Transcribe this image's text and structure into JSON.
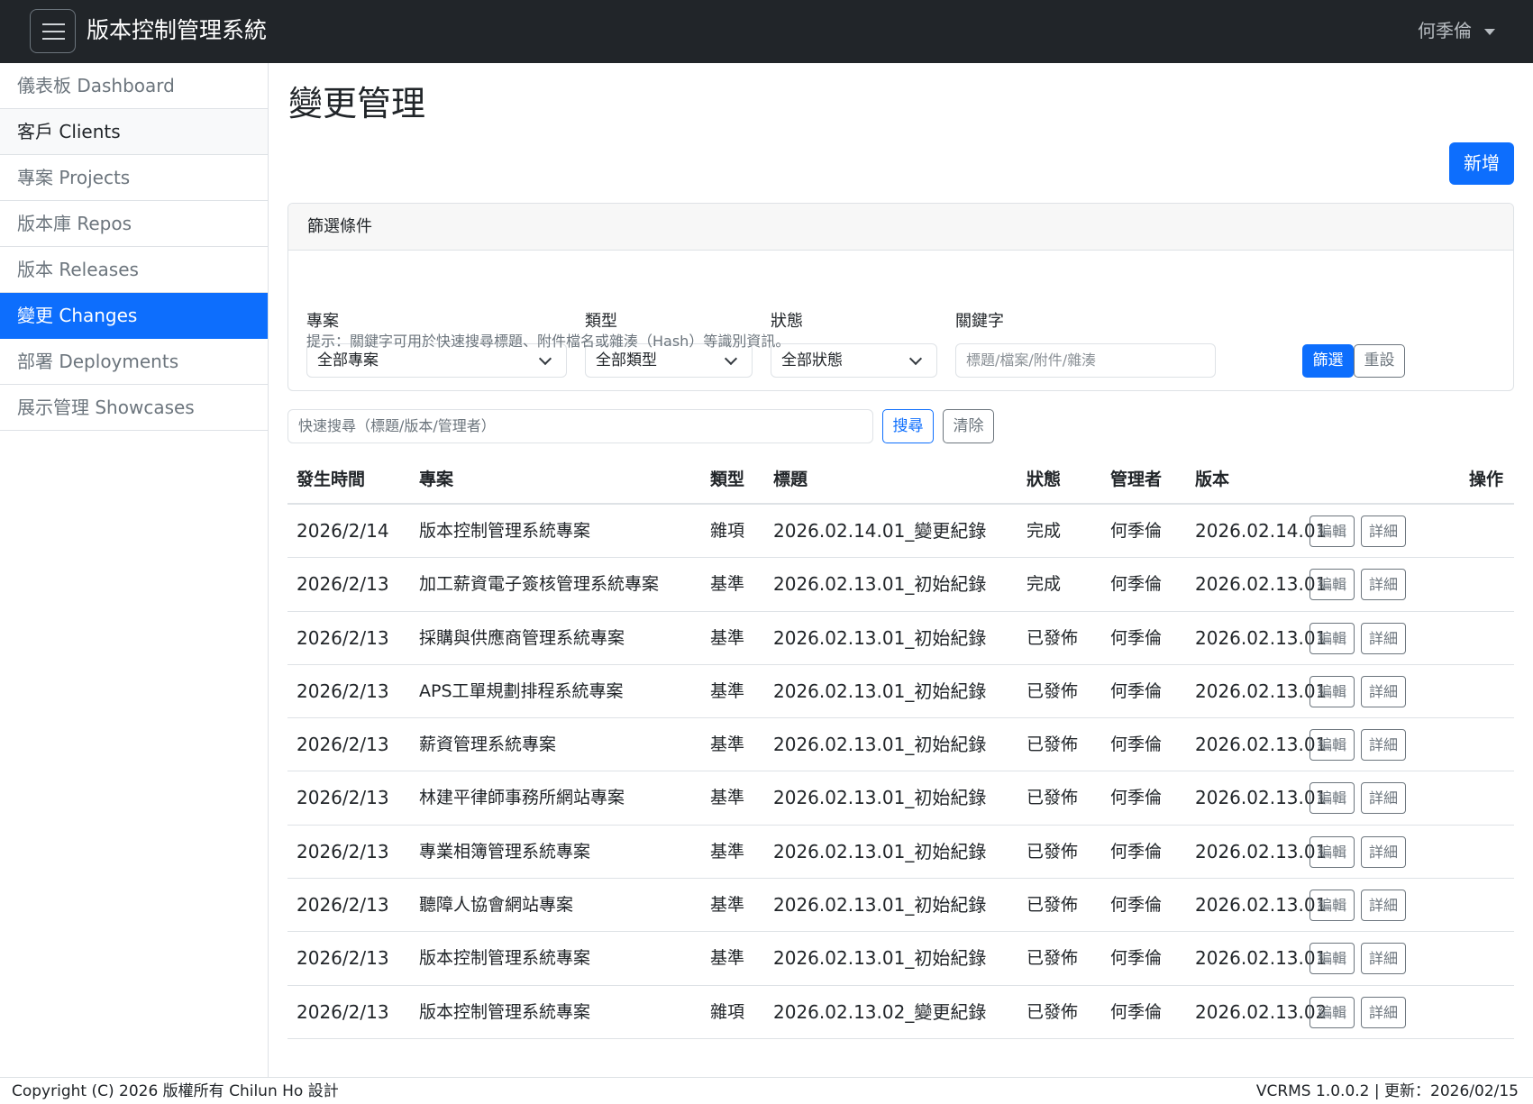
{
  "app": {
    "title": "版本控制管理系統",
    "user": "何季倫"
  },
  "sidebar": {
    "items": [
      {
        "label": "儀表板 Dashboard"
      },
      {
        "label": "客戶 Clients"
      },
      {
        "label": "專案 Projects"
      },
      {
        "label": "版本庫 Repos"
      },
      {
        "label": "版本 Releases"
      },
      {
        "label": "變更 Changes"
      },
      {
        "label": "部署 Deployments"
      },
      {
        "label": "展示管理 Showcases"
      }
    ]
  },
  "page": {
    "title": "變更管理",
    "add_label": "新增"
  },
  "filter": {
    "title": "篩選條件",
    "project_label": "專案",
    "project_value": "全部專案",
    "type_label": "類型",
    "type_value": "全部類型",
    "status_label": "狀態",
    "status_value": "全部狀態",
    "keyword_label": "關鍵字",
    "keyword_placeholder": "標題/檔案/附件/雜湊",
    "filter_label": "篩選",
    "reset_label": "重設",
    "hint": "提示：關鍵字可用於快速搜尋標題、附件檔名或雜湊（Hash）等識別資訊。"
  },
  "search": {
    "placeholder": "快速搜尋（標題/版本/管理者）",
    "search_label": "搜尋",
    "clear_label": "清除"
  },
  "table": {
    "headers": {
      "date": "發生時間",
      "project": "專案",
      "type": "類型",
      "title": "標題",
      "status": "狀態",
      "manager": "管理者",
      "version": "版本",
      "actions": "操作"
    },
    "edit_label": "編輯",
    "detail_label": "詳細",
    "rows": [
      {
        "date": "2026/2/14",
        "project": "版本控制管理系統專案",
        "type": "雜項",
        "title": "2026.02.14.01_變更紀錄",
        "status": "完成",
        "manager": "何季倫",
        "version": "2026.02.14.01"
      },
      {
        "date": "2026/2/13",
        "project": "加工薪資電子簽核管理系統專案",
        "type": "基準",
        "title": "2026.02.13.01_初始紀錄",
        "status": "完成",
        "manager": "何季倫",
        "version": "2026.02.13.01"
      },
      {
        "date": "2026/2/13",
        "project": "採購與供應商管理系統專案",
        "type": "基準",
        "title": "2026.02.13.01_初始紀錄",
        "status": "已發佈",
        "manager": "何季倫",
        "version": "2026.02.13.01"
      },
      {
        "date": "2026/2/13",
        "project": "APS工單規劃排程系統專案",
        "type": "基準",
        "title": "2026.02.13.01_初始紀錄",
        "status": "已發佈",
        "manager": "何季倫",
        "version": "2026.02.13.01"
      },
      {
        "date": "2026/2/13",
        "project": "薪資管理系統專案",
        "type": "基準",
        "title": "2026.02.13.01_初始紀錄",
        "status": "已發佈",
        "manager": "何季倫",
        "version": "2026.02.13.01"
      },
      {
        "date": "2026/2/13",
        "project": "林建平律師事務所網站專案",
        "type": "基準",
        "title": "2026.02.13.01_初始紀錄",
        "status": "已發佈",
        "manager": "何季倫",
        "version": "2026.02.13.01"
      },
      {
        "date": "2026/2/13",
        "project": "專業相簿管理系統專案",
        "type": "基準",
        "title": "2026.02.13.01_初始紀錄",
        "status": "已發佈",
        "manager": "何季倫",
        "version": "2026.02.13.01"
      },
      {
        "date": "2026/2/13",
        "project": "聽障人協會網站專案",
        "type": "基準",
        "title": "2026.02.13.01_初始紀錄",
        "status": "已發佈",
        "manager": "何季倫",
        "version": "2026.02.13.01"
      },
      {
        "date": "2026/2/13",
        "project": "版本控制管理系統專案",
        "type": "基準",
        "title": "2026.02.13.01_初始紀錄",
        "status": "已發佈",
        "manager": "何季倫",
        "version": "2026.02.13.01"
      },
      {
        "date": "2026/2/13",
        "project": "版本控制管理系統專案",
        "type": "雜項",
        "title": "2026.02.13.02_變更紀錄",
        "status": "已發佈",
        "manager": "何季倫",
        "version": "2026.02.13.02"
      }
    ]
  },
  "footer": {
    "copyright": "Copyright (C) 2026 版權所有 Chilun Ho 設計",
    "version_info": "VCRMS 1.0.0.2 | 更新：2026/02/15"
  },
  "colors": {
    "primary": "#0d6efd",
    "navbar": "#212529",
    "muted": "#6c757d"
  }
}
